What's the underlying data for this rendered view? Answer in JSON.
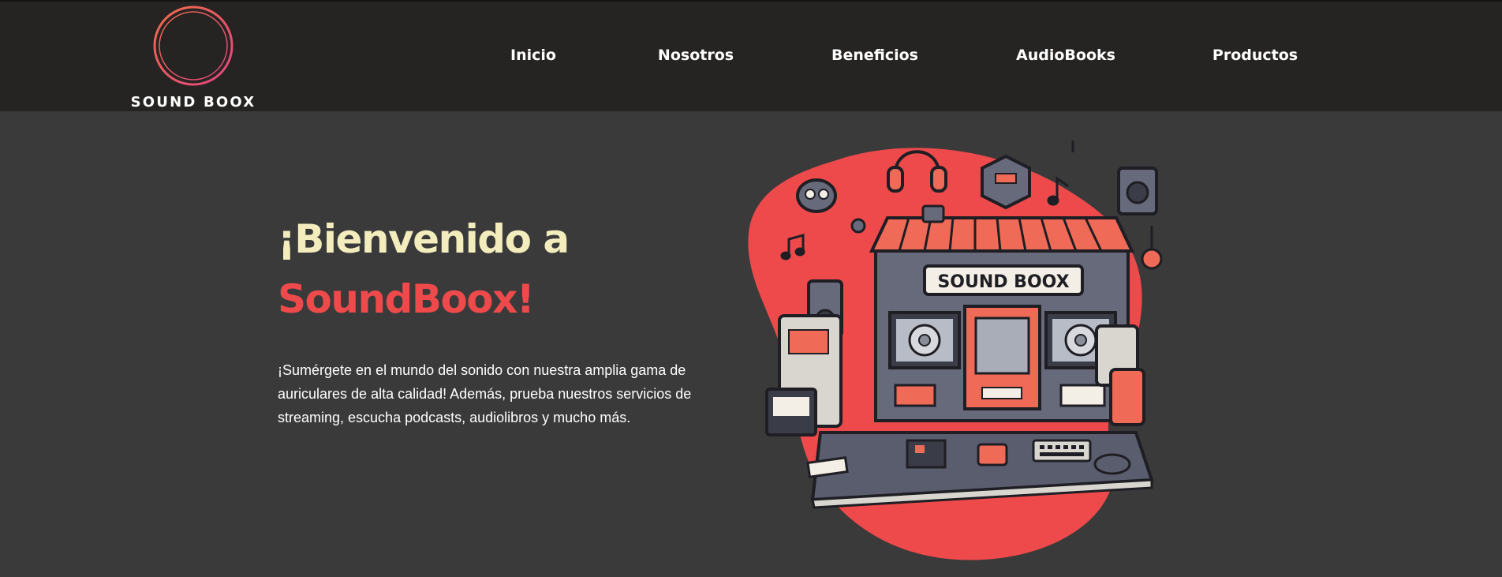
{
  "header": {
    "logo_text": "SOUND BOOX",
    "nav": [
      {
        "label": "Inicio"
      },
      {
        "label": "Nosotros"
      },
      {
        "label": "Beneficios"
      },
      {
        "label": "AudioBooks"
      },
      {
        "label": "Productos"
      }
    ]
  },
  "hero": {
    "title_line1": "¡Bienvenido a",
    "title_line2": "SoundBoox!",
    "description": "¡Sumérgete en el mundo del sonido con nuestra amplia gama de auriculares de alta calidad! Además, prueba nuestros servicios de streaming, escucha podcasts, audiolibros y mucho más.",
    "illustration": {
      "store_sign": "SOUND BOOX"
    }
  },
  "colors": {
    "header_bg": "#252423",
    "page_bg": "#3a3a3a",
    "title_cream": "#f3ecbd",
    "accent_red": "#ef4a4b",
    "logo_gradient_start": "#f05a4a",
    "logo_gradient_end": "#e0447d"
  },
  "icons": [
    "sound-wave-logo-icon"
  ]
}
